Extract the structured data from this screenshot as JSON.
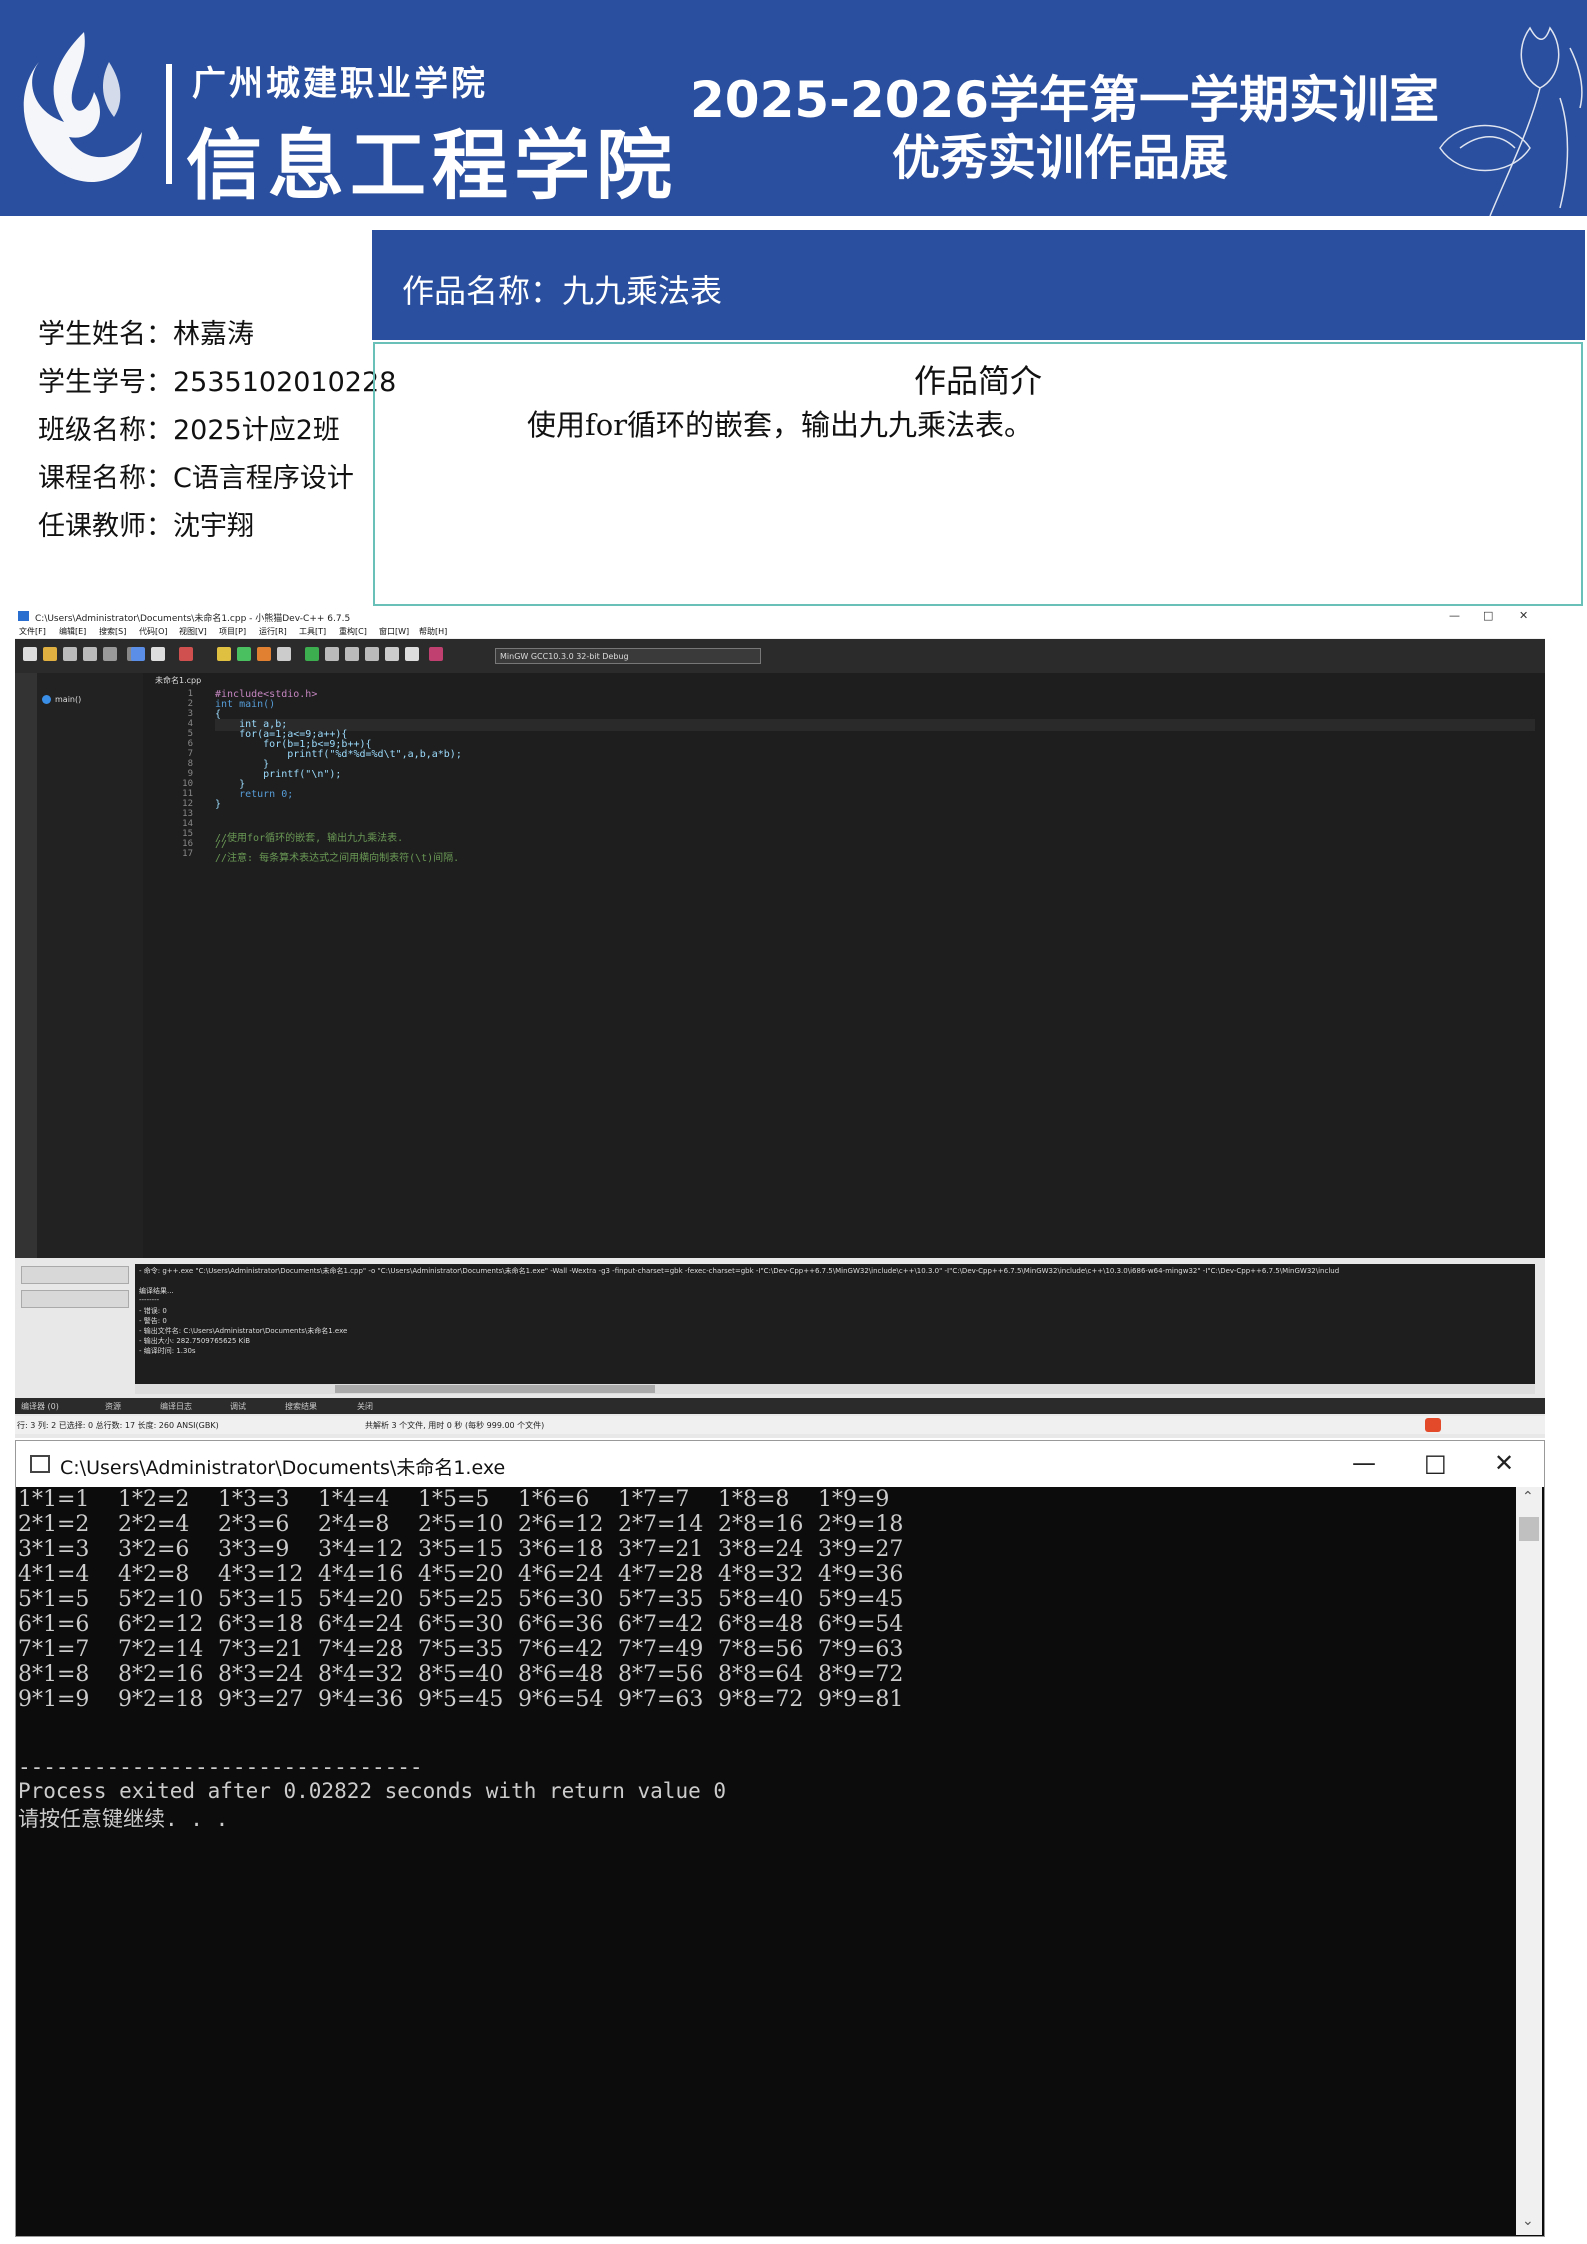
{
  "header": {
    "school_name": "广州城建职业学院",
    "college_name": "信息工程学院",
    "title_line_1": "2025-2026学年第一学期实训室",
    "title_line_2": "优秀实训作品展",
    "brand_color": "#2a4f9e"
  },
  "student": {
    "lines": [
      "学生姓名：林嘉涛",
      "学生学号：2535102010228",
      "班级名称：2025计应2班",
      "课程名称：C语言程序设计",
      "任课教师：沈宇翔"
    ]
  },
  "work": {
    "title": "作品名称：九九乘法表",
    "intro_heading": "作品简介",
    "intro_text": "使用for循环的嵌套，输出九九乘法表。"
  },
  "ide": {
    "window_title": "C:\\Users\\Administrator\\Documents\\未命名1.cpp - 小熊猫Dev-C++ 6.7.5",
    "menu": [
      "文件[F]",
      "编辑[E]",
      "搜索[S]",
      "代码[O]",
      "视图[V]",
      "项目[P]",
      "运行[R]",
      "工具[T]",
      "重构[C]",
      "窗口[W]",
      "帮助[H]"
    ],
    "compiler": "MinGW GCC10.3.0 32-bit Debug",
    "tab": "未命名1.cpp",
    "class_item": "main()",
    "code_lines": [
      "#include<stdio.h>",
      "int main()",
      "{",
      "    int a,b;",
      "    for(a=1;a<=9;a++){",
      "        for(b=1;b<=9;b++){",
      "            printf(\"%d*%d=%d\\t\",a,b,a*b);",
      "        }",
      "        printf(\"\\n\");",
      "    }",
      "    return 0;",
      "}",
      "",
      "",
      "//使用for循环的嵌套, 输出九九乘法表.",
      "//",
      "//注意: 每条算术表达式之间用横向制表符(\\t)间隔."
    ],
    "log_lines": [
      "- 命令: g++.exe \"C:\\Users\\Administrator\\Documents\\未命名1.cpp\" -o \"C:\\Users\\Administrator\\Documents\\未命名1.exe\" -Wall -Wextra -g3 -finput-charset=gbk -fexec-charset=gbk -I\"C:\\Dev-Cpp++6.7.5\\MinGW32\\include\\c++\\10.3.0\" -I\"C:\\Dev-Cpp++6.7.5\\MinGW32\\include\\c++\\10.3.0\\i686-w64-mingw32\" -I\"C:\\Dev-Cpp++6.7.5\\MinGW32\\includ",
      "",
      "编译结果...",
      "--------",
      "- 错误: 0",
      "- 警告: 0",
      "- 输出文件名: C:\\Users\\Administrator\\Documents\\未命名1.exe",
      "- 输出大小: 282.7509765625 KiB",
      "- 编译时间: 1.30s"
    ],
    "bottom_tabs": [
      "编译器 (0)",
      "资源",
      "编译日志",
      "调试",
      "搜索结果",
      "关闭"
    ],
    "status": {
      "left": "行: 3  列: 2 已选择: 0 总行数: 17 长度: 260  ANSI(GBK)",
      "middle": "共解析 3 个文件, 用时 0 秒 (每秒 999.00 个文件)"
    }
  },
  "console": {
    "title": "C:\\Users\\Administrator\\Documents\\未命名1.exe",
    "table": [
      [
        "1*1=1",
        "1*2=2",
        "1*3=3",
        "1*4=4",
        "1*5=5",
        "1*6=6",
        "1*7=7",
        "1*8=8",
        "1*9=9"
      ],
      [
        "2*1=2",
        "2*2=4",
        "2*3=6",
        "2*4=8",
        "2*5=10",
        "2*6=12",
        "2*7=14",
        "2*8=16",
        "2*9=18"
      ],
      [
        "3*1=3",
        "3*2=6",
        "3*3=9",
        "3*4=12",
        "3*5=15",
        "3*6=18",
        "3*7=21",
        "3*8=24",
        "3*9=27"
      ],
      [
        "4*1=4",
        "4*2=8",
        "4*3=12",
        "4*4=16",
        "4*5=20",
        "4*6=24",
        "4*7=28",
        "4*8=32",
        "4*9=36"
      ],
      [
        "5*1=5",
        "5*2=10",
        "5*3=15",
        "5*4=20",
        "5*5=25",
        "5*6=30",
        "5*7=35",
        "5*8=40",
        "5*9=45"
      ],
      [
        "6*1=6",
        "6*2=12",
        "6*3=18",
        "6*4=24",
        "6*5=30",
        "6*6=36",
        "6*7=42",
        "6*8=48",
        "6*9=54"
      ],
      [
        "7*1=7",
        "7*2=14",
        "7*3=21",
        "7*4=28",
        "7*5=35",
        "7*6=42",
        "7*7=49",
        "7*8=56",
        "7*9=63"
      ],
      [
        "8*1=8",
        "8*2=16",
        "8*3=24",
        "8*4=32",
        "8*5=40",
        "8*6=48",
        "8*7=56",
        "8*8=64",
        "8*9=72"
      ],
      [
        "9*1=9",
        "9*2=18",
        "9*3=27",
        "9*4=36",
        "9*5=45",
        "9*6=54",
        "9*7=63",
        "9*8=72",
        "9*9=81"
      ]
    ],
    "separator": "--------------------------------",
    "exit_message": "Process exited after 0.02822 seconds with return value 0",
    "continue_prompt": "请按任意键继续. . ."
  }
}
